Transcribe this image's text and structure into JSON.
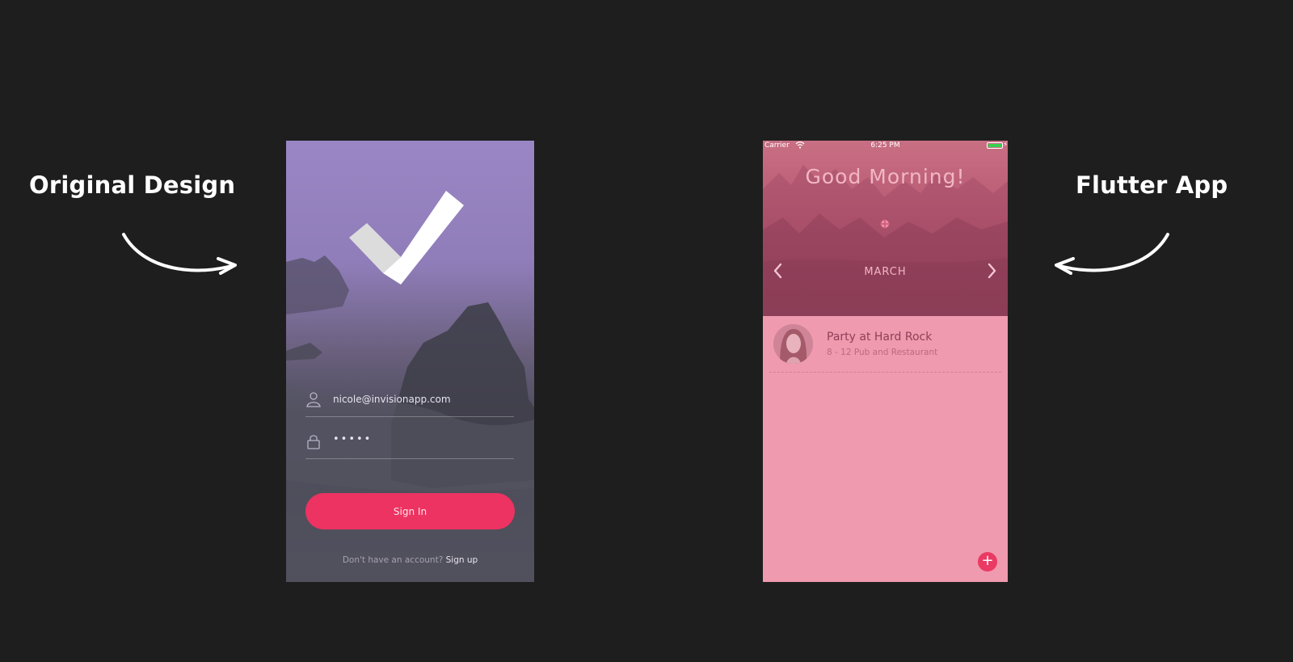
{
  "captions": {
    "left": "Original Design",
    "right": "Flutter App"
  },
  "original_design": {
    "email": "nicole@invisionapp.com",
    "password_mask": "•••••",
    "sign_in_label": "Sign In",
    "signup_prompt": "Don't have an account?",
    "signup_link": "Sign up",
    "colors": {
      "accent": "#ec3361"
    }
  },
  "flutter_app": {
    "status_bar": {
      "carrier": "Carrier",
      "time": "6:25 PM"
    },
    "greeting": "Good Morning!",
    "month": "MARCH",
    "events": [
      {
        "title": "Party at Hard Rock",
        "subtitle": "8 - 12 Pub and Restaurant"
      }
    ],
    "add_label": "+",
    "colors": {
      "accent": "#ea3a63",
      "background": "#ef9aae"
    }
  }
}
